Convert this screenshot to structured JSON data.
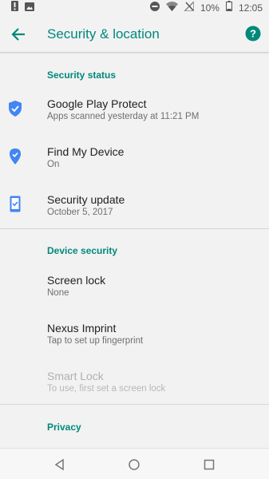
{
  "status_bar": {
    "battery_percent": "10%",
    "time": "12:05",
    "icons": [
      "notification-icon",
      "image-icon",
      "dnd-icon",
      "wifi-icon",
      "no-signal-icon",
      "battery-icon"
    ]
  },
  "app_bar": {
    "title": "Security & location",
    "back_icon": "arrow-back-icon",
    "help_icon": "help-icon"
  },
  "sections": [
    {
      "header": "Security status",
      "items": [
        {
          "title": "Google Play Protect",
          "subtitle": "Apps scanned yesterday at 11:21 PM",
          "icon": "shield-check-icon"
        },
        {
          "title": "Find My Device",
          "subtitle": "On",
          "icon": "location-pin-icon"
        },
        {
          "title": "Security update",
          "subtitle": "October 5, 2017",
          "icon": "phone-check-icon"
        }
      ]
    },
    {
      "header": "Device security",
      "items": [
        {
          "title": "Screen lock",
          "subtitle": "None"
        },
        {
          "title": "Nexus Imprint",
          "subtitle": "Tap to set up fingerprint"
        },
        {
          "title": "Smart Lock",
          "subtitle": "To use, first set a screen lock",
          "disabled": true
        }
      ]
    },
    {
      "header": "Privacy"
    }
  ],
  "nav_bar": {
    "icons": [
      "back-triangle-icon",
      "home-circle-icon",
      "recents-square-icon"
    ]
  },
  "colors": {
    "accent": "#00897b",
    "icon_blue": "#4285f4",
    "background": "#f2f2f2"
  }
}
